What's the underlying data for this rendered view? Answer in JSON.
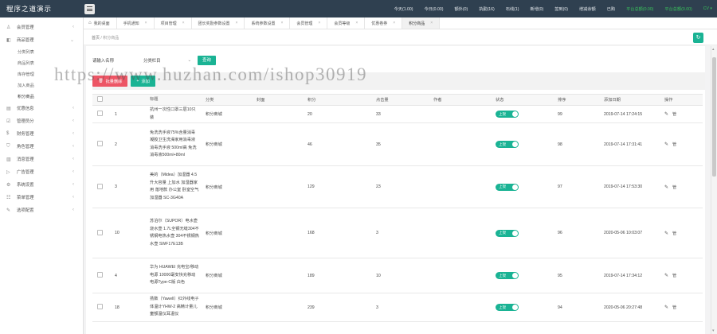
{
  "app": {
    "title": "程序之道演示"
  },
  "topbar": {
    "stats": [
      {
        "label": "今天(1.00)",
        "green": false
      },
      {
        "label": "今日(0.00)",
        "green": false
      },
      {
        "label": "额外(0)",
        "green": false
      },
      {
        "label": "执勤(16)",
        "green": false
      },
      {
        "label": "石线(1)",
        "green": false
      },
      {
        "label": "新增(0)",
        "green": false
      },
      {
        "label": "签到(0)",
        "green": false
      },
      {
        "label": "增减余额",
        "green": false
      },
      {
        "label": "已购",
        "green": false
      },
      {
        "label": "平台总额(0.00)",
        "green": true
      },
      {
        "label": "平台总额(0.00)",
        "green": true
      },
      {
        "label": "CV ▾",
        "green": true
      }
    ]
  },
  "sidebar": {
    "items": [
      {
        "icon": "♙",
        "label": "会员管理",
        "chevron": "‹"
      },
      {
        "icon": "◧",
        "label": "商品管理",
        "chevron": "⌄"
      },
      {
        "sub": true,
        "label": "分类列表"
      },
      {
        "sub": true,
        "label": "商品列表"
      },
      {
        "sub": true,
        "label": "库存管理"
      },
      {
        "sub": true,
        "label": "加入商品"
      },
      {
        "sub": true,
        "label": "积分商品",
        "active": true
      },
      {
        "icon": "▤",
        "label": "优惠信息",
        "chevron": "‹"
      },
      {
        "icon": "☑",
        "label": "管理员分",
        "chevron": "‹"
      },
      {
        "icon": "$",
        "label": "财务管理",
        "chevron": "‹"
      },
      {
        "icon": "⛉",
        "label": "角色管理",
        "chevron": "‹"
      },
      {
        "icon": "▥",
        "label": "消息管理",
        "chevron": "‹"
      },
      {
        "icon": "▷",
        "label": "广告管理",
        "chevron": "‹"
      },
      {
        "icon": "⚙",
        "label": "系统设置",
        "chevron": "‹"
      },
      {
        "icon": "☷",
        "label": "菜单管理",
        "chevron": "‹"
      },
      {
        "icon": "✎",
        "label": "选项配置",
        "chevron": "‹"
      }
    ]
  },
  "tabs": [
    {
      "label": "我的桌面",
      "home": true,
      "close": ""
    },
    {
      "label": "手机通知",
      "close": "×"
    },
    {
      "label": "项目管理",
      "close": "×"
    },
    {
      "label": "团长奖励参数设置",
      "close": "×"
    },
    {
      "label": "系统参数设置",
      "close": "×"
    },
    {
      "label": "会员管理",
      "close": "×"
    },
    {
      "label": "会员等级",
      "close": "×"
    },
    {
      "label": "优惠卷券",
      "close": "×"
    },
    {
      "label": "积分商品",
      "close": "×",
      "active": true
    }
  ],
  "breadcrumb": {
    "home": "首页",
    "sep": "/",
    "current": "积分商品"
  },
  "refresh_icon": "↻",
  "filters": {
    "name_label": "请输入名称",
    "category_label": "分类栏目",
    "category_chevron": "⌄",
    "query_button": "查询"
  },
  "watermark": "https://www.huzhan.com/ishop30919",
  "actions": {
    "batch_delete": "批量删除",
    "batch_delete_icon": "🗑",
    "add": "添加",
    "add_icon": "+"
  },
  "table": {
    "headers": [
      "",
      "",
      "标题",
      "分类",
      "封面",
      "积分",
      "点击量",
      "作者",
      "状态",
      "排序",
      "添加日期",
      "操作"
    ],
    "rows": [
      {
        "id": "1",
        "title": "抗州一次性口罩三层10只装",
        "category": "积分商城",
        "cover": "",
        "points": "20",
        "clicks": "33",
        "author": "",
        "status": "上架",
        "sort": "99",
        "date": "2019-07-14 17:24:15"
      },
      {
        "id": "2",
        "title": "免洗洗手液75%含量消毒凝胶卫生洗澡家用消毒液消毒洗手液 500ml高 免洗消毒液500ml+80ml",
        "category": "积分商城",
        "cover": "",
        "points": "46",
        "clicks": "35",
        "author": "",
        "status": "上架",
        "sort": "98",
        "date": "2019-07-14 17:31:41"
      },
      {
        "id": "3",
        "title": "美的（Midea）加湿器 4.5升大容量 上加水 加湿器家用 落地款 办公室 卧室空气加湿器 SC-3G40A",
        "category": "积分商城",
        "cover": "",
        "points": "129",
        "clicks": "23",
        "author": "",
        "status": "上架",
        "sort": "97",
        "date": "2019-07-14 17:53:30"
      },
      {
        "id": "10",
        "title": "苏泊尔（SUPOR）电水壶烧水壶 1.7L全钢无缝304不锈钢电热水壶 304不锈钢热水壶 SWF17E13B",
        "category": "积分商城",
        "cover": "",
        "points": "168",
        "clicks": "3",
        "author": "",
        "status": "上架",
        "sort": "96",
        "date": "2020-05-06 10:03:07"
      },
      {
        "id": "4",
        "title": "华为 HUAWEI 充电宝/移动电源 10000毫安快充移动电源Type-C版 白色",
        "category": "积分商城",
        "cover": "",
        "points": "189",
        "clicks": "10",
        "author": "",
        "status": "上架",
        "sort": "95",
        "date": "2019-07-14 17:34:12"
      },
      {
        "id": "18",
        "title": "扬数（Yawell）红外线电子体温计YHW-2 高精计量儿童额温仪耳温仪",
        "category": "积分商城",
        "cover": "",
        "points": "239",
        "clicks": "3",
        "author": "",
        "status": "上架",
        "sort": "94",
        "date": "2020-05-06 20:27:48"
      }
    ],
    "ops_edit_icon": "✎",
    "ops_edit": "",
    "ops_delete": "管"
  }
}
